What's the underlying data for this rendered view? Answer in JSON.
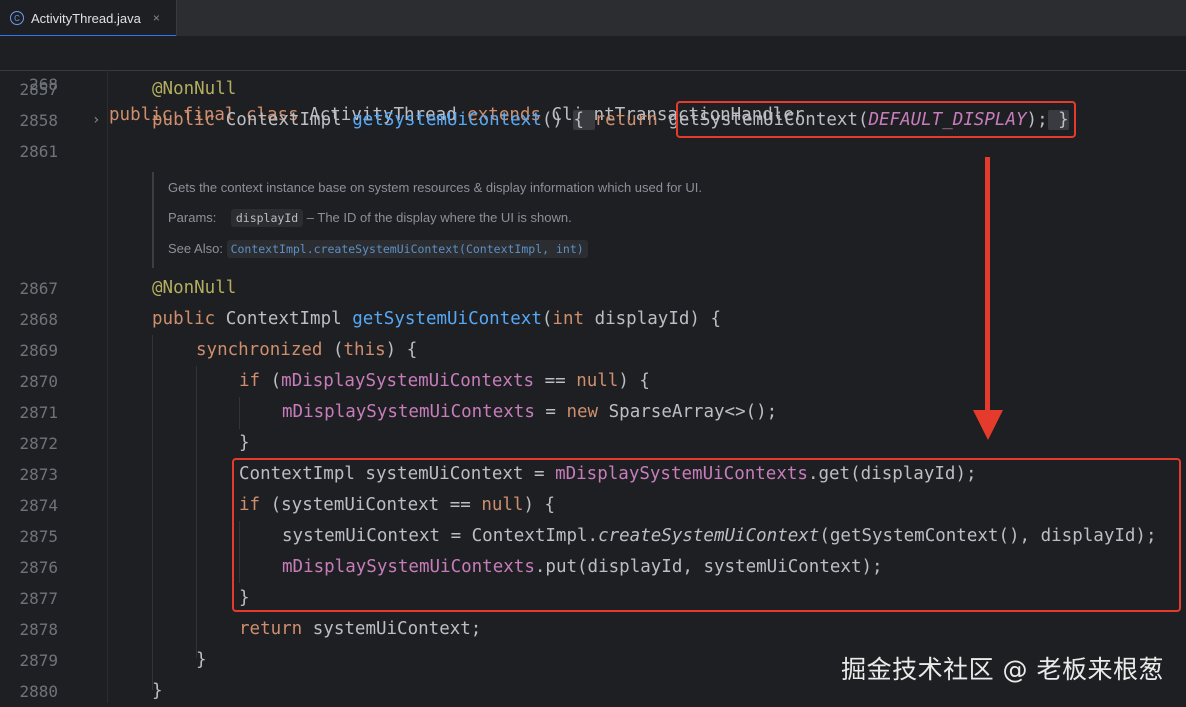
{
  "tab": {
    "icon": "java-class-icon",
    "title": "ActivityThread.java",
    "close": "×"
  },
  "sticky": {
    "line_no": "268",
    "code": [
      {
        "t": "public final class ",
        "c": "kw"
      },
      {
        "t": "ActivityThread ",
        "c": ""
      },
      {
        "t": "extends ",
        "c": "kw"
      },
      {
        "t": "ClientTransactionHandler",
        "c": ""
      }
    ]
  },
  "lines": [
    {
      "n": "2857",
      "indent": 1,
      "code": [
        {
          "t": "@NonNull",
          "c": "ann"
        }
      ]
    },
    {
      "n": "2858",
      "indent": 1,
      "fold": "›",
      "code": [
        {
          "t": "public ",
          "c": "kw"
        },
        {
          "t": "ContextImpl ",
          "c": ""
        },
        {
          "t": "getSystemUiContext",
          "c": "fn"
        },
        {
          "t": "() ",
          "c": ""
        },
        {
          "t": "{ ",
          "c": "brace-box"
        },
        {
          "t": "return ",
          "c": "kw"
        },
        {
          "t": "getSystemUiContext(",
          "c": ""
        },
        {
          "t": "DEFAULT_DISPLAY",
          "c": "const"
        },
        {
          "t": ");",
          "c": ""
        },
        {
          "t": " }",
          "c": "brace-box"
        }
      ]
    },
    {
      "n": "2861",
      "indent": 0,
      "code": []
    },
    {
      "n": "2867",
      "indent": 1,
      "code": [
        {
          "t": "@NonNull",
          "c": "ann"
        }
      ]
    },
    {
      "n": "2868",
      "indent": 1,
      "code": [
        {
          "t": "public ",
          "c": "kw"
        },
        {
          "t": "ContextImpl ",
          "c": ""
        },
        {
          "t": "getSystemUiContext",
          "c": "fn"
        },
        {
          "t": "(",
          "c": ""
        },
        {
          "t": "int ",
          "c": "kw"
        },
        {
          "t": "displayId) {",
          "c": ""
        }
      ]
    },
    {
      "n": "2869",
      "indent": 2,
      "code": [
        {
          "t": "synchronized ",
          "c": "kw"
        },
        {
          "t": "(",
          "c": ""
        },
        {
          "t": "this",
          "c": "kw"
        },
        {
          "t": ") {",
          "c": ""
        }
      ]
    },
    {
      "n": "2870",
      "indent": 3,
      "code": [
        {
          "t": "if ",
          "c": "kw"
        },
        {
          "t": "(",
          "c": ""
        },
        {
          "t": "mDisplaySystemUiContexts",
          "c": "field"
        },
        {
          "t": " == ",
          "c": ""
        },
        {
          "t": "null",
          "c": "kw"
        },
        {
          "t": ") {",
          "c": ""
        }
      ]
    },
    {
      "n": "2871",
      "indent": 4,
      "code": [
        {
          "t": "mDisplaySystemUiContexts",
          "c": "field"
        },
        {
          "t": " = ",
          "c": ""
        },
        {
          "t": "new ",
          "c": "kw"
        },
        {
          "t": "SparseArray<>();",
          "c": ""
        }
      ]
    },
    {
      "n": "2872",
      "indent": 3,
      "code": [
        {
          "t": "}",
          "c": ""
        }
      ]
    },
    {
      "n": "2873",
      "indent": 3,
      "code": [
        {
          "t": "ContextImpl systemUiContext = ",
          "c": ""
        },
        {
          "t": "mDisplaySystemUiContexts",
          "c": "field"
        },
        {
          "t": ".get(displayId);",
          "c": ""
        }
      ]
    },
    {
      "n": "2874",
      "indent": 3,
      "code": [
        {
          "t": "if ",
          "c": "kw"
        },
        {
          "t": "(systemUiContext == ",
          "c": ""
        },
        {
          "t": "null",
          "c": "kw"
        },
        {
          "t": ") {",
          "c": ""
        }
      ]
    },
    {
      "n": "2875",
      "indent": 4,
      "code": [
        {
          "t": "systemUiContext = ContextImpl.",
          "c": ""
        },
        {
          "t": "createSystemUiContext",
          "c": "it"
        },
        {
          "t": "(getSystemContext(), displayId);",
          "c": ""
        }
      ]
    },
    {
      "n": "2876",
      "indent": 4,
      "code": [
        {
          "t": "mDisplaySystemUiContexts",
          "c": "field"
        },
        {
          "t": ".put(displayId, systemUiContext);",
          "c": ""
        }
      ]
    },
    {
      "n": "2877",
      "indent": 3,
      "code": [
        {
          "t": "}",
          "c": ""
        }
      ]
    },
    {
      "n": "2878",
      "indent": 3,
      "code": [
        {
          "t": "return ",
          "c": "kw"
        },
        {
          "t": "systemUiContext;",
          "c": ""
        }
      ]
    },
    {
      "n": "2879",
      "indent": 2,
      "code": [
        {
          "t": "}",
          "c": ""
        }
      ]
    },
    {
      "n": "2880",
      "indent": 1,
      "code": [
        {
          "t": "}",
          "c": ""
        }
      ]
    }
  ],
  "doc": {
    "summary": "Gets the context instance base on system resources & display information which used for UI.",
    "params_label": "Params:",
    "param_name": "displayId",
    "param_desc": " – The ID of the display where the UI is shown.",
    "see_also_label": "See Also:",
    "see_also_link": "ContextImpl.createSystemUiContext(ContextImpl, int)"
  },
  "watermark": "掘金技术社区 @ 老板来根葱",
  "colors": {
    "background": "#1e1f22",
    "keyword": "#cf8e6d",
    "function": "#56a8f5",
    "field": "#c77dbb",
    "annotation": "#b3ae60",
    "highlight_box": "#e53b2c"
  }
}
